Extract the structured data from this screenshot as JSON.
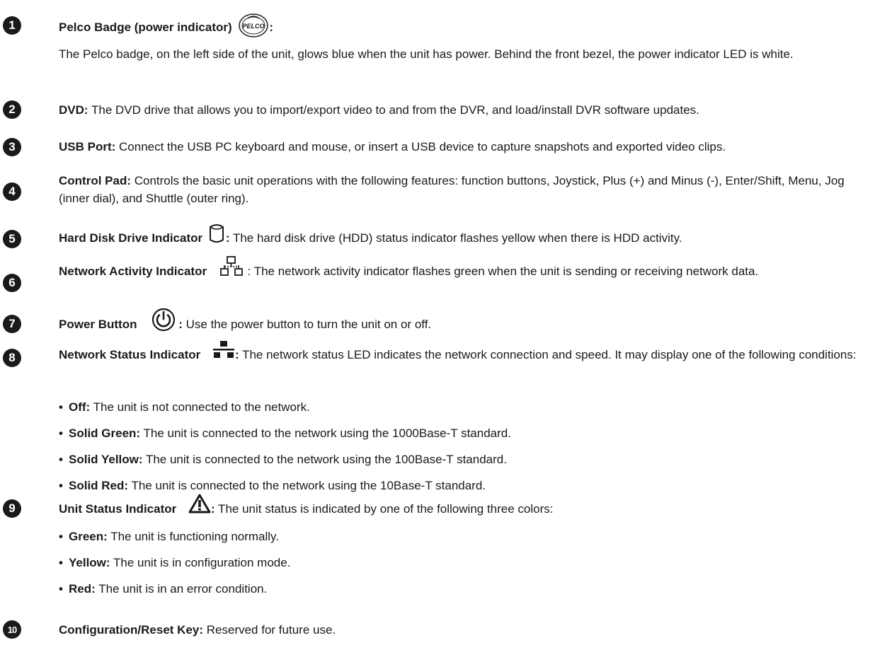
{
  "items": [
    {
      "number": "1",
      "title": "Pelco Badge (power indicator)",
      "colon": ":",
      "text": "The Pelco badge, on the left side of the unit, glows blue when the unit has power. Behind the front bezel, the power indicator LED is white.",
      "logo_text": "PELCO"
    },
    {
      "number": "2",
      "title": "DVD:",
      "text": " The DVD drive that allows you to import/export video to and from the DVR, and load/install DVR software updates."
    },
    {
      "number": "3",
      "title": "USB Port:",
      "text": " Connect the USB PC keyboard and mouse, or insert a USB device to capture snapshots and exported video clips."
    },
    {
      "number": "4",
      "title": "Control Pad:",
      "text": " Controls the basic unit operations with the following features: function buttons, Joystick, Plus (+) and Minus (-), Enter/Shift, Menu, Jog (inner dial), and Shuttle (outer ring)."
    },
    {
      "number": "5",
      "title": "Hard Disk Drive Indicator",
      "colon": ":",
      "text": " The hard disk drive (HDD) status indicator flashes yellow when there is HDD activity."
    },
    {
      "number": "6",
      "title": "Network Activity Indicator",
      "text": " : The network activity indicator flashes green when the unit is sending or receiving network data."
    },
    {
      "number": "7",
      "title": "Power Button",
      "colon": ":",
      "text": " Use the power button to turn the unit on or off."
    },
    {
      "number": "8",
      "title": "Network Status Indicator",
      "colon": ":",
      "text": " The network status LED indicates the network connection and speed. It may display one of the following conditions:",
      "bullets": [
        {
          "label": "Off:",
          "text": " The unit is not connected to the network."
        },
        {
          "label": "Solid Green:",
          "text": " The unit is connected to the network using the 1000Base-T standard."
        },
        {
          "label": "Solid Yellow:",
          "text": " The unit is connected to the network using the 100Base-T standard."
        },
        {
          "label": "Solid Red:",
          "text": " The unit is connected to the network using the 10Base-T standard."
        }
      ]
    },
    {
      "number": "9",
      "title": "Unit Status Indicator",
      "colon": ":",
      "text": " The unit status is indicated by one of the following three colors:",
      "bullets": [
        {
          "label": "Green:",
          "text": " The unit is functioning normally."
        },
        {
          "label": "Yellow:",
          "text": " The unit is in configuration mode."
        },
        {
          "label": "Red:",
          "text": " The unit is in an error condition."
        }
      ]
    },
    {
      "number": "10",
      "title": "Configuration/Reset Key:",
      "text": " Reserved for future use."
    }
  ],
  "icons": {
    "item1": "pelco-logo-icon",
    "item5": "hard-disk-icon",
    "item6": "network-activity-icon",
    "item7": "power-icon",
    "item8": "network-status-icon",
    "item9": "warning-triangle-icon"
  },
  "bullet_glyph": "•"
}
